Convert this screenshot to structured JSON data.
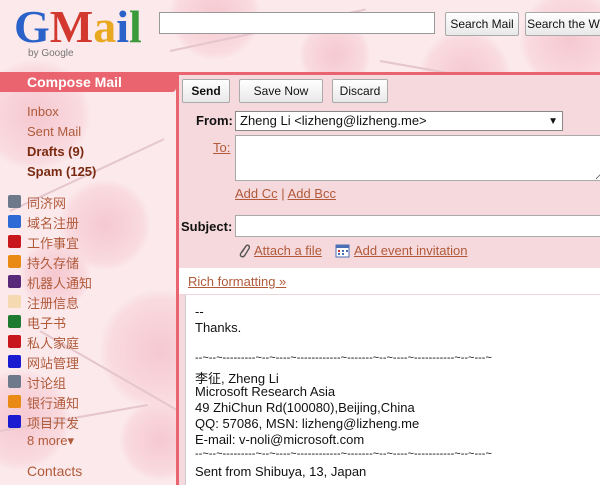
{
  "header": {
    "logo": {
      "brand": "GMail",
      "by_line": "by Google"
    },
    "search": {
      "placeholder": "",
      "search_mail_label": "Search Mail",
      "search_web_label": "Search the Web"
    }
  },
  "sidebar": {
    "compose_label": "Compose Mail",
    "folders": [
      {
        "label": "Inbox",
        "bold": false
      },
      {
        "label": "Sent Mail",
        "bold": false
      },
      {
        "label": "Drafts (9)",
        "bold": true
      },
      {
        "label": "Spam (125)",
        "bold": true
      }
    ],
    "labels": [
      {
        "name": "同济网",
        "color": "#6e7a8c"
      },
      {
        "name": "域名注册",
        "color": "#2d6ad6"
      },
      {
        "name": "工作事宜",
        "color": "#c8161d"
      },
      {
        "name": "持久存储",
        "color": "#e88a14"
      },
      {
        "name": "机器人通知",
        "color": "#5a2a7a"
      },
      {
        "name": "注册信息",
        "color": "#f5d9b0"
      },
      {
        "name": "电子书",
        "color": "#1e7a2e"
      },
      {
        "name": "私人家庭",
        "color": "#c8161d"
      },
      {
        "name": "网站管理",
        "color": "#1a1ad0"
      },
      {
        "name": "讨论组",
        "color": "#6e7a8c"
      },
      {
        "name": "银行通知",
        "color": "#e88a14"
      },
      {
        "name": "项目开发",
        "color": "#1a1ad0"
      }
    ],
    "more_label": "8 more▾",
    "contacts_label": "Contacts"
  },
  "compose": {
    "buttons": {
      "send": "Send",
      "save_now": "Save Now",
      "discard": "Discard"
    },
    "from_label": "From:",
    "from_value": "Zheng Li <lizheng@lizheng.me>",
    "to_label": "To:",
    "add_cc": "Add Cc",
    "separator": "|",
    "add_bcc": "Add Bcc",
    "subject_label": "Subject:",
    "attach_label": "Attach a file",
    "event_label": "Add event invitation",
    "rich_formatting": "Rich formatting »",
    "body_lines": [
      "--",
      "Thanks.",
      "",
      "--~--~---------~--~----~------------~-------~--~----~-----------~--~---~",
      "李征, Zheng Li",
      "Microsoft Research Asia",
      "49 ZhiChun Rd(100080),Beijing,China",
      "QQ: 57086, MSN: lizheng@lizheng.me",
      "E-mail: v-noli@microsoft.com",
      "--~--~---------~--~----~------------~-------~--~----~-----------~--~---~",
      "Sent from Shibuya, 13, Japan"
    ]
  },
  "colors": {
    "accent": "#e9646e",
    "panel": "#f6d9dd",
    "link": "#b05a3a"
  }
}
